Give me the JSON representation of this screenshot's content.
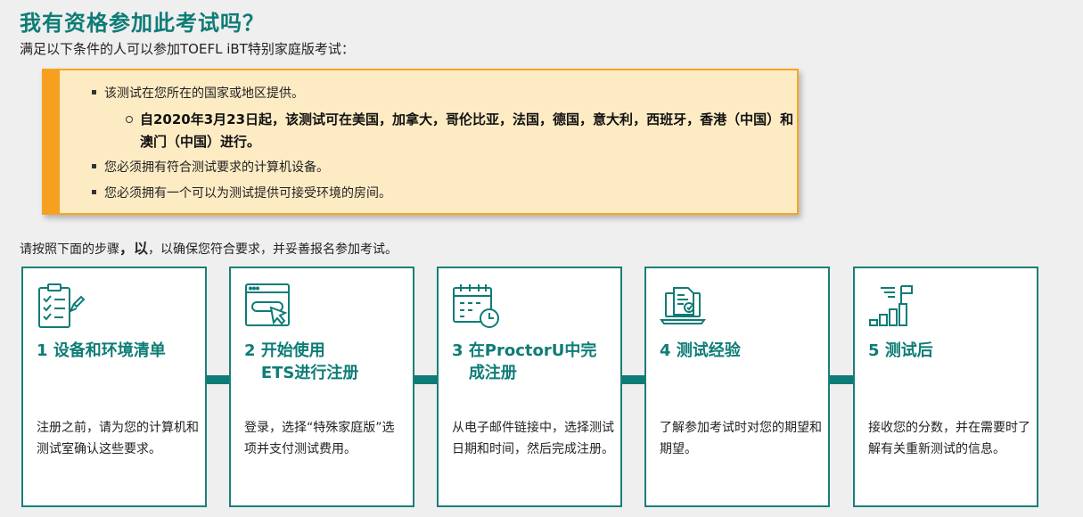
{
  "header": {
    "title": "我有资格参加此考试吗？",
    "subtitle": "满足以下条件的人可以参加TOEFL iBT特别家庭版考试："
  },
  "notice": {
    "items": [
      "该测试在您所在的国家或地区提供。",
      "您必须拥有符合测试要求的计算机设备。",
      "您必须拥有一个可以为测试提供可接受环境的房间。"
    ],
    "sub_item": "自2020年3月23日起，该测试可在美国，加拿大，哥伦比亚，法国，德国，意大利，西班牙，香港（中国）和澳门（中国）进行。"
  },
  "steps_intro": {
    "before": "请按照下面的步骤",
    "bold": "，以",
    "after": "，以确保您符合要求，并妥善报名参加考试。"
  },
  "steps": [
    {
      "number": "1",
      "title": "设备和环境清单",
      "icon": "checklist-icon",
      "desc": "注册之前，请为您的计算机和测试室确认这些要求。"
    },
    {
      "number": "2",
      "title_line1": "开始使用",
      "title_line2": "ETS进行注册",
      "icon": "browser-click-icon",
      "desc": "登录，选择“特殊家庭版”选项并支付测试费用。"
    },
    {
      "number": "3",
      "title_line1": "在ProctorU中完",
      "title_line2": "成注册",
      "icon": "calendar-clock-icon",
      "desc": "从电子邮件链接中，选择测试日期和时间，然后完成注册。"
    },
    {
      "number": "4",
      "title": "测试经验",
      "icon": "laptop-document-icon",
      "desc": "了解参加考试时对您的期望和期望。"
    },
    {
      "number": "5",
      "title": "测试后",
      "icon": "bar-chart-flag-icon",
      "desc": "接收您的分数，并在需要时了解有关重新测试的信息。"
    }
  ],
  "colors": {
    "teal": "#0e7c76",
    "notice_bg": "#fdebc4",
    "notice_accent": "#f7a01f"
  }
}
